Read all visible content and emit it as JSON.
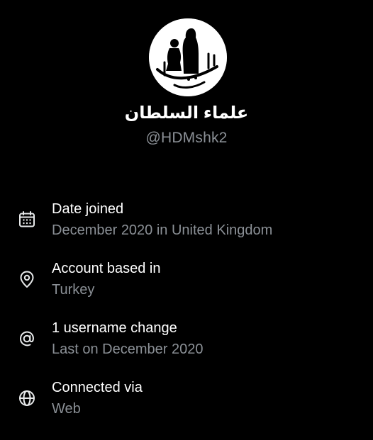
{
  "profile": {
    "display_name": "علماء السلطان",
    "handle": "@HDMshk2",
    "avatar_logo_text": "علماء السلطان"
  },
  "info": [
    {
      "icon": "calendar-icon",
      "title": "Date joined",
      "value": "December 2020 in United Kingdom"
    },
    {
      "icon": "location-pin-icon",
      "title": "Account based in",
      "value": "Turkey"
    },
    {
      "icon": "at-sign-icon",
      "title": "1 username change",
      "value": "Last on December 2020"
    },
    {
      "icon": "globe-icon",
      "title": "Connected via",
      "value": "Web"
    }
  ],
  "colors": {
    "background": "#000000",
    "primary_text": "#ffffff",
    "secondary_text": "#8b9096"
  }
}
